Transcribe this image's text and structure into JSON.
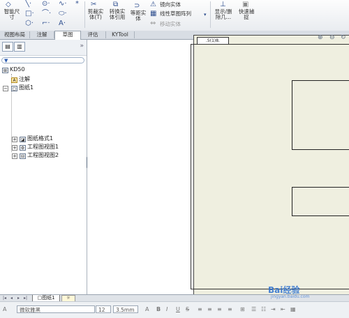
{
  "ribbon": {
    "smart_dimension": "智能尺\n寸",
    "trim_entities": "剪裁实\n体(T)",
    "convert_entities": "转换实\n体引用",
    "offset_entities": "等距实\n体",
    "mirror_entities": "镜向实体",
    "linear_pattern": "线性草图阵列",
    "move_entities": "移动实体",
    "display_delete_relations": "显示/删\n除几...",
    "quick_snaps": "快速捕\n捉"
  },
  "tabs": [
    {
      "label": "视图布局"
    },
    {
      "label": "注解"
    },
    {
      "label": "草图",
      "active": true
    },
    {
      "label": "评估"
    },
    {
      "label": "KYTool"
    }
  ],
  "feature_tree": {
    "root": "KD50",
    "annotations": "注解",
    "sheet": "图纸1",
    "sheet_format": "图纸格式1",
    "drawing_view1": "工程图视图1",
    "drawing_view2": "工程图视图2"
  },
  "sheet_tab": {
    "label": "图纸1"
  },
  "sheet_tag": {
    "text": ".5(1)8."
  },
  "format_bar": {
    "font": "微软雅黑",
    "size": "12",
    "height": "3.5mm"
  },
  "watermark": {
    "text": "Bai经验",
    "sub": "jingyan.baidu.com"
  }
}
